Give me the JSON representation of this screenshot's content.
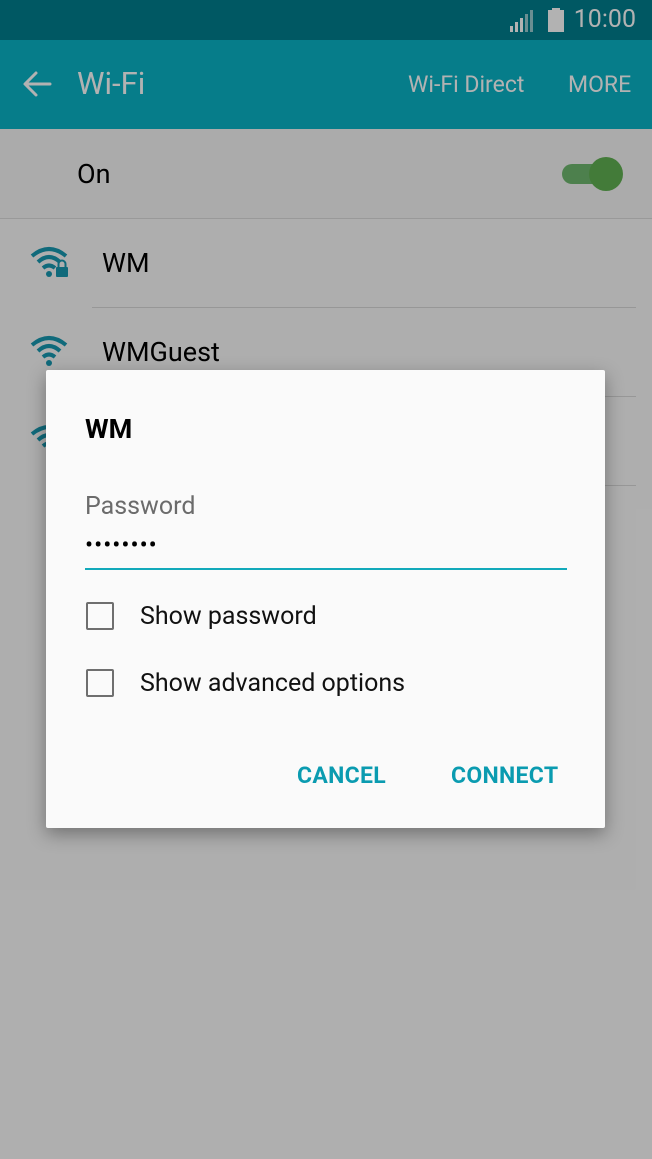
{
  "status_bar": {
    "time": "10:00"
  },
  "app_bar": {
    "title": "Wi-Fi",
    "wifi_direct": "Wi-Fi Direct",
    "more": "MORE"
  },
  "master_switch": {
    "label": "On",
    "state": "on"
  },
  "networks": [
    {
      "name": "WM",
      "secured": true
    },
    {
      "name": "WMGuest",
      "secured": false
    },
    {
      "name": "",
      "secured": false
    }
  ],
  "dialog": {
    "title": "WM",
    "password_label": "Password",
    "password_value": "••••••••",
    "show_password": "Show password",
    "show_advanced": "Show advanced options",
    "cancel": "CANCEL",
    "connect": "CONNECT"
  },
  "colors": {
    "status_bar": "#007f8e",
    "app_bar": "#0ab4c6",
    "accent": "#0a9bb0",
    "toggle_on": "#61b152"
  }
}
